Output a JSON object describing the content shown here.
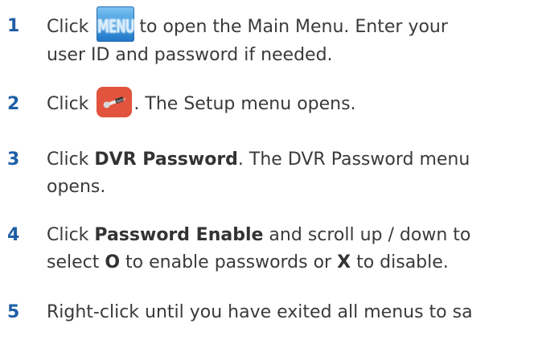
{
  "steps": [
    {
      "number": "1",
      "lines": [
        [
          "Click ",
          "to open the Main Menu. Enter your"
        ],
        [
          "user ID and password if needed."
        ]
      ],
      "icon": "menu-button-icon",
      "icon_label": "MENU"
    },
    {
      "number": "2",
      "parts": [
        "Click ",
        ". The Setup menu opens."
      ],
      "icon": "setup-wrench-icon"
    },
    {
      "number": "3",
      "parts": [
        "Click ",
        "DVR Password",
        ". The DVR Password menu"
      ],
      "line2": "opens."
    },
    {
      "number": "4",
      "parts": [
        "Click ",
        "Password Enable",
        " and scroll up / down to"
      ],
      "line2": [
        "select ",
        "O",
        " to enable passwords or ",
        "X",
        " to disable."
      ]
    },
    {
      "number": "5",
      "text": "Right-click until you have exited all menus to sa"
    }
  ],
  "colors": {
    "step_number": "#1f5fa6",
    "body_text": "#3a3a3a",
    "menu_icon_blue": "#4a9fe0",
    "setup_icon_border": "#e2543e"
  }
}
